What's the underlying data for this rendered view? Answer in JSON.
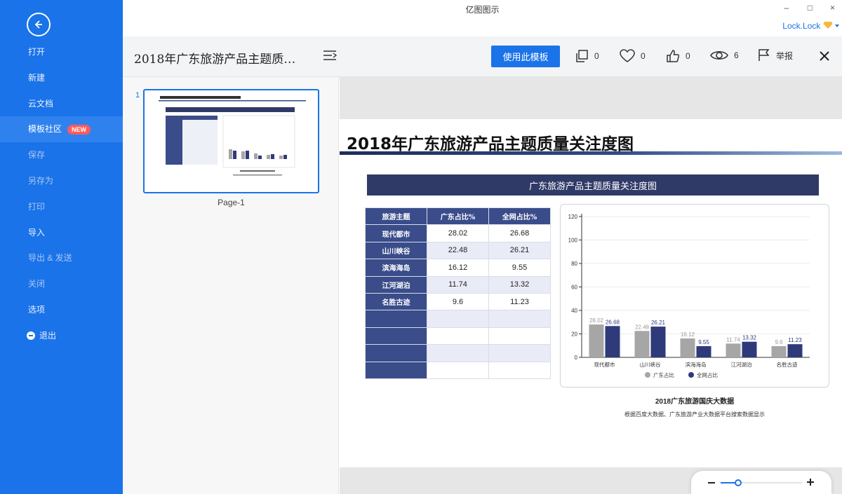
{
  "app": {
    "title": "亿图图示",
    "user": "Lock.Lock",
    "win_min": "–",
    "win_max": "□",
    "win_close": "×"
  },
  "sidebar": {
    "items": [
      {
        "label": "打开"
      },
      {
        "label": "新建"
      },
      {
        "label": "云文档"
      },
      {
        "label": "模板社区",
        "badge": "NEW"
      },
      {
        "label": "保存"
      },
      {
        "label": "另存为"
      },
      {
        "label": "打印"
      },
      {
        "label": "导入"
      },
      {
        "label": "导出 & 发送"
      },
      {
        "label": "关闭"
      },
      {
        "label": "选项"
      },
      {
        "label": "退出"
      }
    ]
  },
  "toolbar": {
    "doc_title": "2018年广东旅游产品主题质…",
    "use_template": "使用此模板",
    "copy_count": "0",
    "like_count": "0",
    "thumb_count": "0",
    "view_count": "6",
    "report": "举报"
  },
  "thumbs": {
    "page_number": "1",
    "page_label": "Page-1"
  },
  "document": {
    "main_title": "2018年广东旅游产品主题质量关注度图",
    "banner": "广东旅游产品主题质量关注度图",
    "table": {
      "headers": [
        "旅游主题",
        "广东占比%",
        "全网占比%"
      ],
      "rows": [
        [
          "现代都市",
          "28.02",
          "26.68"
        ],
        [
          "山川峡谷",
          "22.48",
          "26.21"
        ],
        [
          "滨海海岛",
          "16.12",
          "9.55"
        ],
        [
          "江河湖泊",
          "11.74",
          "13.32"
        ],
        [
          "名胜古迹",
          "9.6",
          "11.23"
        ]
      ]
    },
    "source_title": "2018广东旅游国庆大数据",
    "source_note": "根据百度大数据、广东旅游产业大数据平台搜索数据显示"
  },
  "chart_data": {
    "type": "bar",
    "categories": [
      "现代都市",
      "山川峡谷",
      "滨海海岛",
      "江河湖泊",
      "名胜古迹"
    ],
    "series": [
      {
        "name": "广东占比",
        "values": [
          28.02,
          22.48,
          16.12,
          11.74,
          9.6
        ],
        "color": "#a6a6a6"
      },
      {
        "name": "全网占比",
        "values": [
          26.68,
          26.21,
          9.55,
          13.32,
          11.23
        ],
        "color": "#2f3a7a"
      }
    ],
    "ylim": [
      0,
      120
    ],
    "yticks": [
      "0",
      "20",
      "40",
      "60",
      "80",
      "100",
      "120"
    ],
    "grid": true,
    "legend": "bottom"
  },
  "colors": {
    "accent": "#1a73e8",
    "navy": "#2f3a67",
    "badge": "#ff5b5b"
  }
}
